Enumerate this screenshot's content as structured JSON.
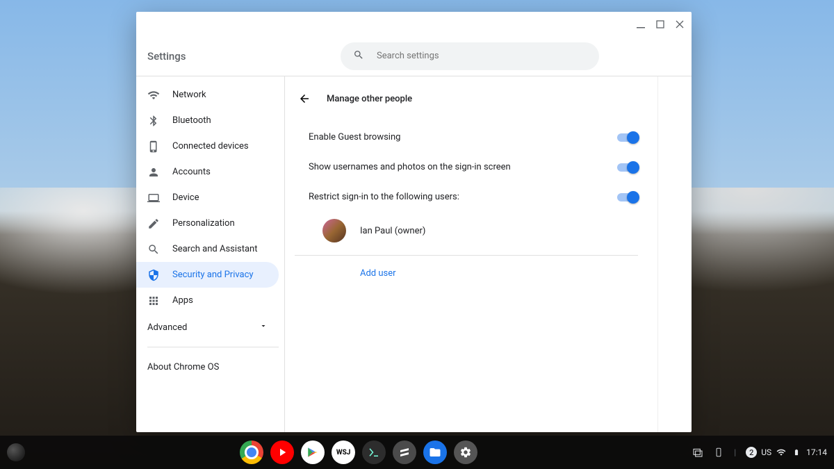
{
  "header": {
    "title": "Settings"
  },
  "search": {
    "placeholder": "Search settings"
  },
  "sidebar": {
    "items": [
      {
        "label": "Network"
      },
      {
        "label": "Bluetooth"
      },
      {
        "label": "Connected devices"
      },
      {
        "label": "Accounts"
      },
      {
        "label": "Device"
      },
      {
        "label": "Personalization"
      },
      {
        "label": "Search and Assistant"
      },
      {
        "label": "Security and Privacy"
      },
      {
        "label": "Apps"
      }
    ],
    "advanced": "Advanced",
    "about": "About Chrome OS"
  },
  "page": {
    "title": "Manage other people",
    "settings": [
      {
        "label": "Enable Guest browsing",
        "on": true
      },
      {
        "label": "Show usernames and photos on the sign-in screen",
        "on": true
      },
      {
        "label": "Restrict sign-in to the following users:",
        "on": true
      }
    ],
    "user": "Ian Paul (owner)",
    "add_user": "Add user"
  },
  "shelf": {
    "notif_count": "2",
    "lang": "US",
    "time": "17:14"
  }
}
